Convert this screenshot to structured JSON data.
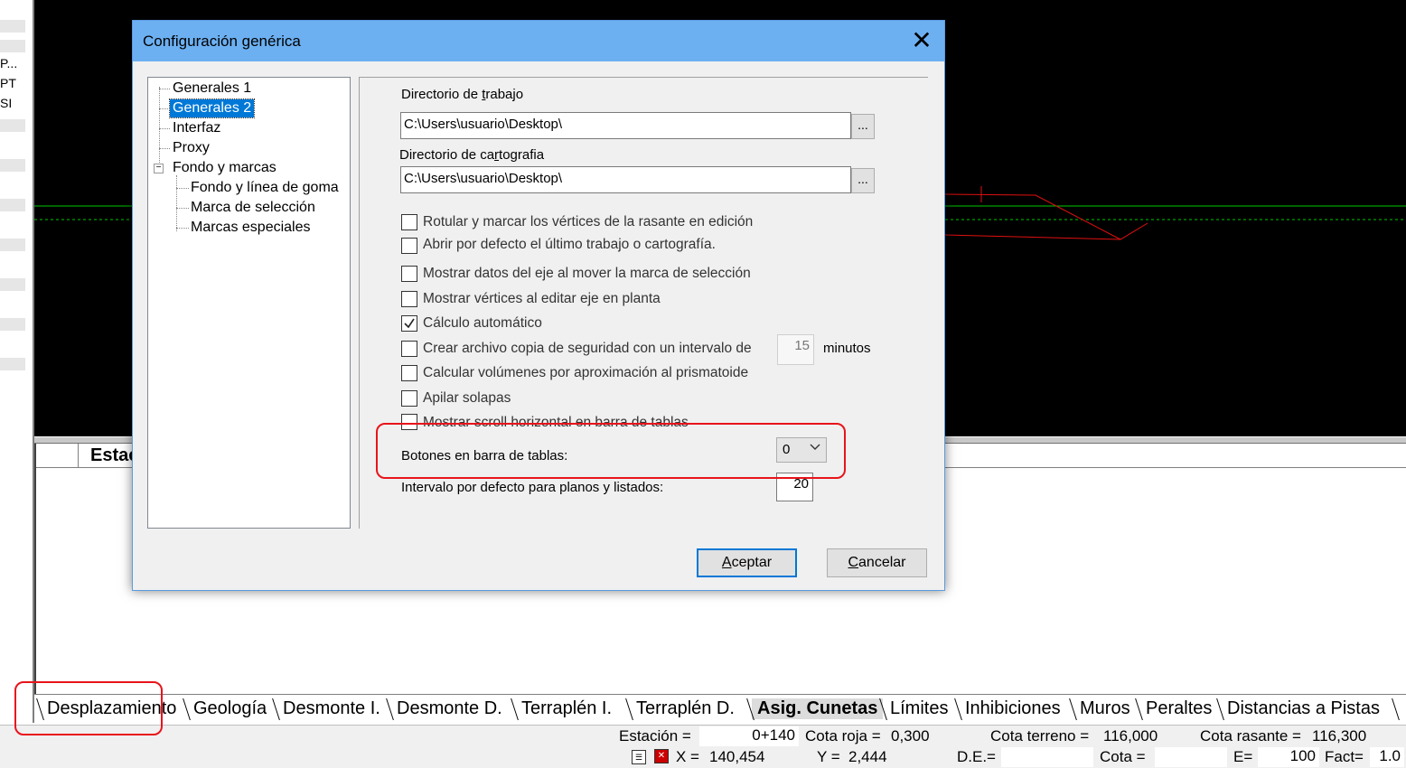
{
  "left_panel": {
    "labels": [
      "P...",
      "PT",
      "SI"
    ]
  },
  "table": {
    "first_column_header": "Estac"
  },
  "bottom_tabs": [
    "Desplazamiento",
    "Geología",
    "Desmonte I.",
    "Desmonte D.",
    "Terraplén  I.",
    "Terraplén  D.",
    "Asig. Cunetas",
    "Límites",
    "Inhibiciones",
    "Muros",
    "Peraltes",
    "Distancias a Pistas"
  ],
  "active_tab": "Asig. Cunetas",
  "status": {
    "estacion_label": "Estación =",
    "estacion_value": "0+140",
    "cota_roja_label": "Cota roja =",
    "cota_roja_value": "0,300",
    "cota_terreno_label": "Cota terreno =",
    "cota_terreno_value": "116,000",
    "cota_rasante_label": "Cota rasante =",
    "cota_rasante_value": "116,300",
    "x_label": "X =",
    "x_value": "140,454",
    "y_label": "Y =",
    "y_value": "2,444",
    "de_label": "D.E.=",
    "de_value": "",
    "cota_label": "Cota =",
    "cota_value": "",
    "e_label": "E=",
    "e_value": "100",
    "fact_label": "Fact=",
    "fact_value": "1.0"
  },
  "dialog": {
    "title": "Configuración genérica",
    "close_glyph": "✕",
    "tree": {
      "items": [
        "Generales 1",
        "Generales 2",
        "Interfaz",
        "Proxy",
        "Fondo y marcas"
      ],
      "children": [
        "Fondo y línea de goma",
        "Marca de selección",
        "Marcas especiales"
      ],
      "selected": "Generales 2",
      "toggle_glyph": "−"
    },
    "directorio_trabajo": {
      "label_pre": "Directorio de ",
      "label_key": "t",
      "label_post": "rabajo",
      "value": "C:\\Users\\usuario\\Desktop\\"
    },
    "directorio_cartografia": {
      "label_pre": "Directorio de ca",
      "label_key": "r",
      "label_post": "tografia",
      "value": "C:\\Users\\usuario\\Desktop\\"
    },
    "browse_label": "...",
    "checkboxes": [
      {
        "label": "Rotular y marcar los vértices de la rasante en edición",
        "checked": false
      },
      {
        "label": "Abrir por defecto el último trabajo o cartografía.",
        "checked": false
      },
      {
        "label": "Mostrar datos del eje al mover la marca de selección",
        "checked": false
      },
      {
        "label": "Mostrar vértices al editar eje en planta",
        "checked": false
      },
      {
        "label": "Cálculo automático",
        "checked": true
      },
      {
        "label": "Crear archivo copia de seguridad con un intervalo de",
        "checked": false
      },
      {
        "label": "Calcular volúmenes por aproximación al prismatoide",
        "checked": false
      },
      {
        "label": "Apilar solapas",
        "checked": false
      },
      {
        "label": "Mostrar scroll horizontal en barra de tablas",
        "checked": false
      }
    ],
    "backup_interval": "15",
    "backup_unit": "minutos",
    "botones_label": "Botones en barra de tablas:",
    "botones_value": "0",
    "intervalo_label": "Intervalo por defecto para planos y listados:",
    "intervalo_value": "20",
    "ok": {
      "key": "A",
      "rest": "ceptar"
    },
    "cancel": {
      "key": "C",
      "rest": "ancelar"
    }
  },
  "colors": {
    "annotation": "#e8141b",
    "title_bar": "#6cb0f2",
    "selection": "#0078d7",
    "canvas": "#000000",
    "axis_line": "#00c800",
    "profile_line": "#e01010"
  }
}
